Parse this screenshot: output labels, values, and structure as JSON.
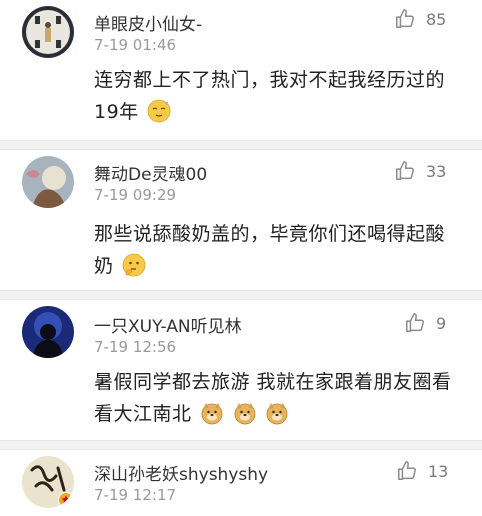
{
  "comments": [
    {
      "username": "单眼皮小仙女-",
      "time": "7-19 01:46",
      "likes": "85",
      "text": "连穷都上不了热门，我对不起我经历过的19年",
      "emoji": [
        "sleepy-sweat-emoji"
      ]
    },
    {
      "username": "舞动De灵魂00",
      "time": "7-19 09:29",
      "likes": "33",
      "text": "那些说舔酸奶盖的，毕竟你们还喝得起酸奶",
      "emoji": [
        "thinking-emoji"
      ]
    },
    {
      "username": "一只XUY-AN听见林",
      "time": "7-19 12:56",
      "likes": "9",
      "text": "暑假同学都去旅游 我就在家跟着朋友圈看看大江南北",
      "emoji": [
        "doge-emoji",
        "doge-emoji",
        "doge-emoji"
      ]
    },
    {
      "username": "深山孙老妖shyshyshy",
      "time": "7-19 12:17",
      "likes": "13",
      "text": "",
      "emoji": []
    }
  ]
}
